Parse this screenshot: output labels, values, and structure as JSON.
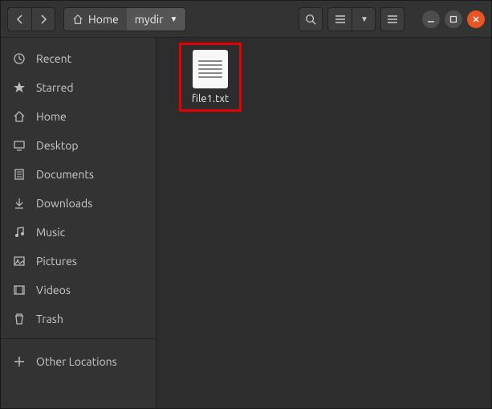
{
  "path": {
    "home_label": "Home",
    "current_label": "mydir"
  },
  "sidebar": {
    "items": [
      {
        "label": "Recent"
      },
      {
        "label": "Starred"
      },
      {
        "label": "Home"
      },
      {
        "label": "Desktop"
      },
      {
        "label": "Documents"
      },
      {
        "label": "Downloads"
      },
      {
        "label": "Music"
      },
      {
        "label": "Pictures"
      },
      {
        "label": "Videos"
      },
      {
        "label": "Trash"
      }
    ],
    "other_locations": "Other Locations"
  },
  "files": [
    {
      "name": "file1.txt"
    }
  ]
}
